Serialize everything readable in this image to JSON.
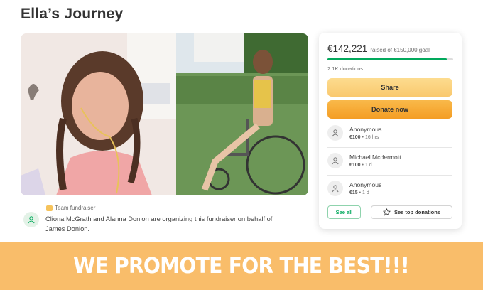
{
  "page": {
    "title": "Ella’s Journey"
  },
  "organizer": {
    "team_label": "Team fundraiser",
    "description": "Cliona McGrath and Alanna Donlon are organizing this fundraiser on behalf of James Donlon."
  },
  "donation_card": {
    "raised": "€142,221",
    "goal_text": "raised of €150,000 goal",
    "progress": 0.948,
    "donation_count": "2.1K donations",
    "share_label": "Share",
    "donate_label": "Donate now",
    "donors": [
      {
        "name": "Anonymous",
        "amount": "€100",
        "time": "16 hrs"
      },
      {
        "name": "Michael Mcdermott",
        "amount": "€100",
        "time": "1 d"
      },
      {
        "name": "Anonymous",
        "amount": "€15",
        "time": "1 d"
      }
    ],
    "see_all_label": "See all",
    "see_top_label": "See top donations"
  },
  "banner": {
    "text": "WE PROMOTE FOR THE BEST!!!"
  },
  "colors": {
    "accent_green": "#02a95c",
    "donate_orange": "#f49d24",
    "banner": "#f9bd6a"
  },
  "icons": {
    "donor": "user-heart-icon",
    "star": "star-icon",
    "team": "team-icon"
  }
}
